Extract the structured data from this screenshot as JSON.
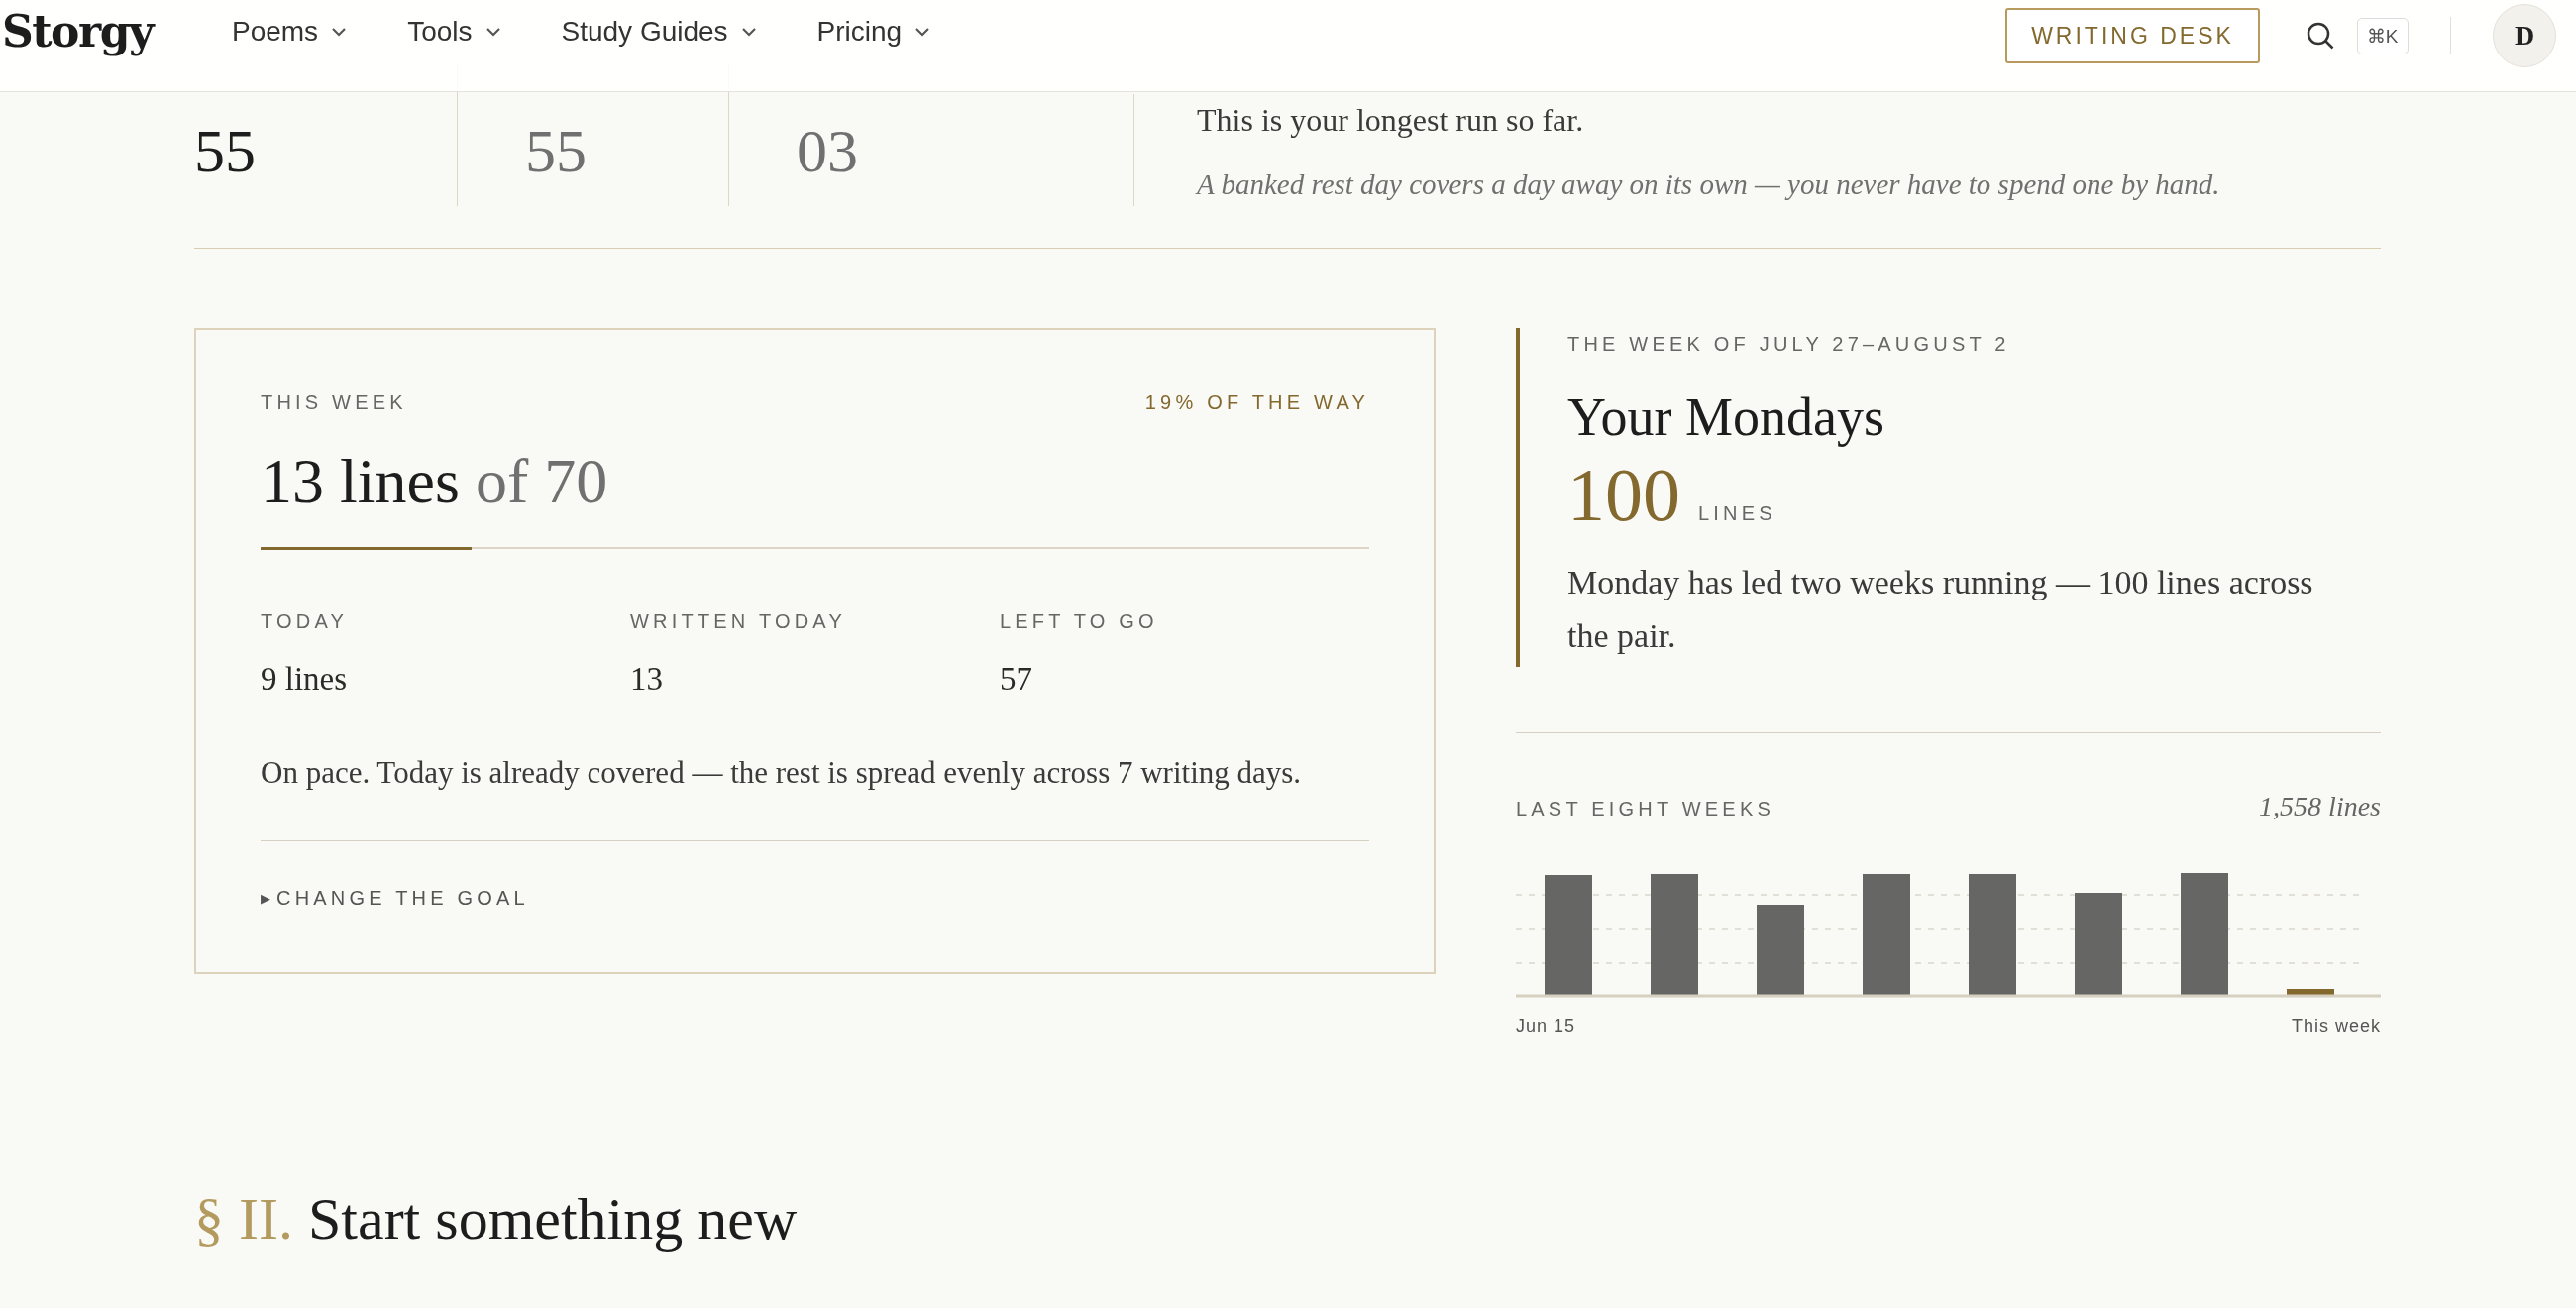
{
  "header": {
    "logo": "Storgy",
    "nav": [
      {
        "label": "Poems"
      },
      {
        "label": "Tools"
      },
      {
        "label": "Study Guides"
      },
      {
        "label": "Pricing"
      }
    ],
    "button": "WRITING DESK",
    "shortcut": "⌘K",
    "avatar": "D"
  },
  "run_stats": {
    "items": [
      {
        "value": "55",
        "kind": "current"
      },
      {
        "value": "55",
        "kind": "past"
      },
      {
        "value": "03",
        "kind": "past"
      }
    ],
    "note": "This is your longest run so far.",
    "hint": "A banked rest day covers a day away on its own — you never have to spend one by hand."
  },
  "week_card": {
    "label": "THIS WEEK",
    "progress_text": "19% OF THE WAY",
    "count": "13 lines",
    "goal": "of 70",
    "level": 0.19,
    "stats": [
      {
        "label": "TODAY",
        "value": "9 lines"
      },
      {
        "label": "WRITTEN TODAY",
        "value": "13"
      },
      {
        "label": "LEFT TO GO",
        "value": "57"
      }
    ],
    "message": "On pace. Today is already covered — the rest is spread evenly across 7 writing days.",
    "toggle_icon": "▶",
    "toggle": "CHANGE THE GOAL"
  },
  "highlight": {
    "week": "THE WEEK OF JULY 27–AUGUST 2",
    "title": "Your Mondays",
    "number": "100",
    "unit": "LINES",
    "text": "Monday has led two weeks running — 100 lines across the pair."
  },
  "history": {
    "label": "LAST EIGHT WEEKS",
    "total": "1,558 lines",
    "start_label": "Jun 15",
    "end_label": "This week"
  },
  "next_section": {
    "marker": "§ II.",
    "title": "Start something new"
  }
}
